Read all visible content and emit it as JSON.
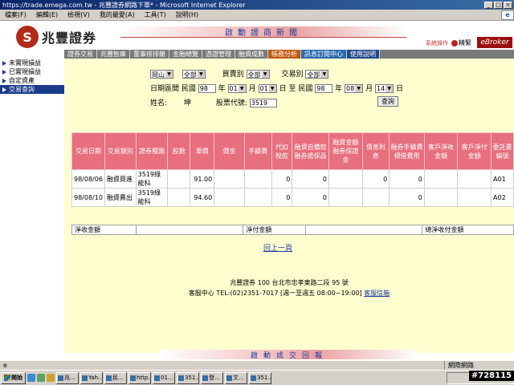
{
  "window": {
    "title": "https://trade.emega.com.tw - 兆豐證券網路下單* - Microsoft Internet Explorer",
    "menu": [
      "檔案(F)",
      "編輯(E)",
      "檢視(V)",
      "我的最愛(A)",
      "工具(T)",
      "說明(H)"
    ]
  },
  "header": {
    "logo_mark": "S",
    "logo_name": "兆豐證券",
    "news_banner": "啟動證商新聞",
    "sysop": "系統操作",
    "home": "精緊",
    "ebroker": "eBroker"
  },
  "nav": [
    {
      "label": "證券交易",
      "style": "normal"
    },
    {
      "label": "兆豐智庫",
      "style": "normal"
    },
    {
      "label": "董事排排雜",
      "style": "normal"
    },
    {
      "label": "金融總覽",
      "style": "normal"
    },
    {
      "label": "憑證管理",
      "style": "normal"
    },
    {
      "label": "融資成數",
      "style": "normal"
    },
    {
      "label": "帳務分析",
      "style": "active"
    },
    {
      "label": "訊息訂閱中心",
      "style": "ops"
    },
    {
      "label": "使用說明",
      "style": "blue"
    }
  ],
  "sidebar": [
    {
      "label": "未實現損益",
      "active": false
    },
    {
      "label": "已實現損益",
      "active": false
    },
    {
      "label": "自定資產",
      "active": false
    },
    {
      "label": "交易查詢",
      "active": true
    }
  ],
  "search": {
    "region": "岡山",
    "branch": "全部",
    "ticket_type_label": "買賣別",
    "ticket_type": "全部",
    "trade_type_label": "交易別",
    "trade_type": "全部",
    "date_label": "日期區間",
    "era": "民國",
    "from_year": "98",
    "from_month": "01",
    "from_day": "01",
    "to_label": "至",
    "to_year": "98",
    "to_month": "08",
    "to_day": "14",
    "year_unit": "年",
    "month_unit": "月",
    "day_unit": "日",
    "name_label": "姓名:",
    "name_value": "坤",
    "stock_label": "股票代號:",
    "stock_value": "3519",
    "query_button": "查詢"
  },
  "table": {
    "headers": [
      "交易日期",
      "交易類別",
      "證券種類",
      "股數",
      "單價",
      "價金",
      "手續費",
      "代扣稅款",
      "融資自備款融券擔保品",
      "融資金額融券保證金",
      "債息利息",
      "融券手續費標借費用",
      "客戶淨收金額",
      "客戶淨付金額",
      "委託書編號"
    ],
    "rows": [
      [
        "98/08/06",
        "融資買進",
        "3519綠能科",
        "",
        "91.00",
        "",
        "",
        "0",
        "0",
        "",
        "0",
        "0",
        "",
        "",
        "A01"
      ],
      [
        "98/08/10",
        "融資賣出",
        "3519綠能科",
        "",
        "94.60",
        "",
        "",
        "0",
        "0",
        "",
        "",
        "0",
        "",
        "",
        "A02"
      ]
    ],
    "summary": {
      "net_receive": "淨收金額",
      "net_pay": "淨付金額",
      "total_net": "總淨收付金額"
    }
  },
  "back_link": "回上一頁",
  "footer": {
    "address": "兆豐證券 100 台北市忠孝東路二段 95 號",
    "service": "客服中心 TEL:(02)2351-7017 [週一至週五 08:00~19:00]",
    "mailbox": "客服信箱"
  },
  "bottom_banner": "啟動成交回報",
  "status": {
    "zone": "網際網路"
  },
  "taskbar": {
    "start": "開始",
    "tasks": [
      "兆...",
      "Yah...",
      "民...",
      "http...",
      "01...",
      "351...",
      "發...",
      "文...",
      "351..."
    ]
  },
  "watermark": "#728115"
}
